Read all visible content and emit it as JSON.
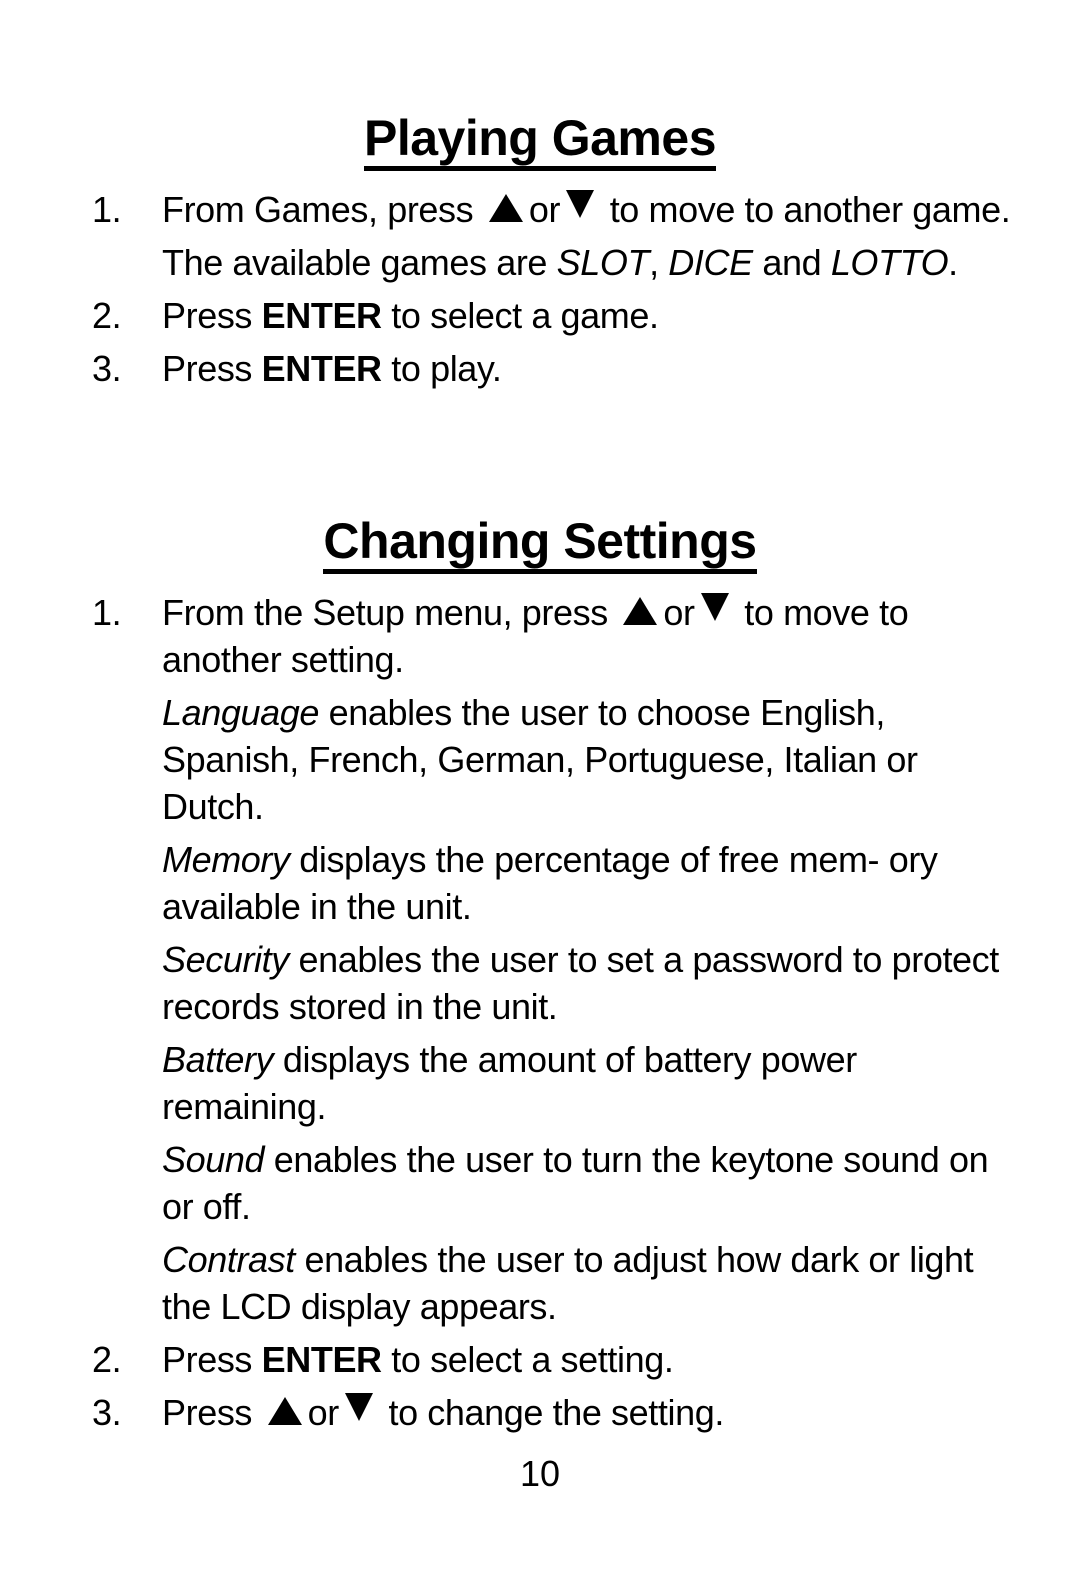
{
  "sections": {
    "playing_games": {
      "title": "Playing Games",
      "step1": {
        "num": "1.",
        "pre": "From Games, press",
        "or": "or",
        "post": "to move to another game."
      },
      "step1_note": {
        "pre": "The available games are",
        "g1": "SLOT",
        "comma": ",",
        "g2": "DICE",
        "and": "and",
        "g3": "LOTTO",
        "end": "."
      },
      "step2": {
        "num": "2.",
        "pre": "Press",
        "key": "ENTER",
        "post": "to select a game."
      },
      "step3": {
        "num": "3.",
        "pre": "Press",
        "key": "ENTER",
        "post": "to play."
      }
    },
    "changing_settings": {
      "title": "Changing Settings",
      "step1": {
        "num": "1.",
        "pre": "From the Setup menu, press",
        "or": "or",
        "post": "to move to another setting."
      },
      "settings": [
        {
          "name": "Language",
          "desc": "enables the user to choose English, Spanish, French, German, Portuguese, Italian or Dutch."
        },
        {
          "name": "Memory",
          "desc": "displays the percentage of free mem- ory available in the unit."
        },
        {
          "name": "Security",
          "desc": "enables the user to set a password to protect records stored in the unit."
        },
        {
          "name": "Battery",
          "desc": "displays the amount of battery power remaining."
        },
        {
          "name": "Sound",
          "desc": "enables the user to turn the keytone sound on or off."
        },
        {
          "name": "Contrast",
          "desc": "enables the user to adjust how dark or light the LCD display appears."
        }
      ],
      "step2": {
        "num": "2.",
        "pre": "Press",
        "key": "ENTER",
        "post": "to select a setting."
      },
      "step3": {
        "num": "3.",
        "pre": "Press",
        "or": "or",
        "post": "to change the setting."
      }
    }
  },
  "icons": {
    "up": "up-arrow-triangle",
    "down": "down-arrow-triangle"
  },
  "page_number": "10"
}
